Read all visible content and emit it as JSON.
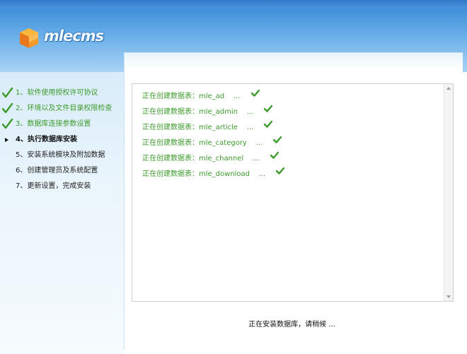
{
  "brand": {
    "name": "mlecms"
  },
  "steps": [
    {
      "label": "1、软件使用授权许可协议",
      "state": "done"
    },
    {
      "label": "2、环境以及文件目录权限检查",
      "state": "done"
    },
    {
      "label": "3、数据库连接参数设置",
      "state": "done"
    },
    {
      "label": "4、执行数据库安装",
      "state": "current"
    },
    {
      "label": "5、安装系统模块及附加数据",
      "state": "pending"
    },
    {
      "label": "6、创建管理员及系统配置",
      "state": "pending"
    },
    {
      "label": "7、更新设置，完成安装",
      "state": "pending"
    }
  ],
  "log": [
    {
      "text": "正在创建数据表：mle_ad    ...",
      "icon": "check-icon"
    },
    {
      "text": "正在创建数据表：mle_admin    ...",
      "icon": "check-icon"
    },
    {
      "text": "正在创建数据表：mle_article    ...",
      "icon": "check-icon"
    },
    {
      "text": "正在创建数据表：mle_category    ...",
      "icon": "check-icon"
    },
    {
      "text": "正在创建数据表：mle_channel    ...",
      "icon": "check-icon"
    },
    {
      "text": "正在创建数据表：mle_download    ...",
      "icon": "check-icon"
    }
  ],
  "status": {
    "text": "正在安装数据库，请稍候 ..."
  },
  "colors": {
    "done": "#3c9a2b",
    "header": "#4d95dc"
  }
}
